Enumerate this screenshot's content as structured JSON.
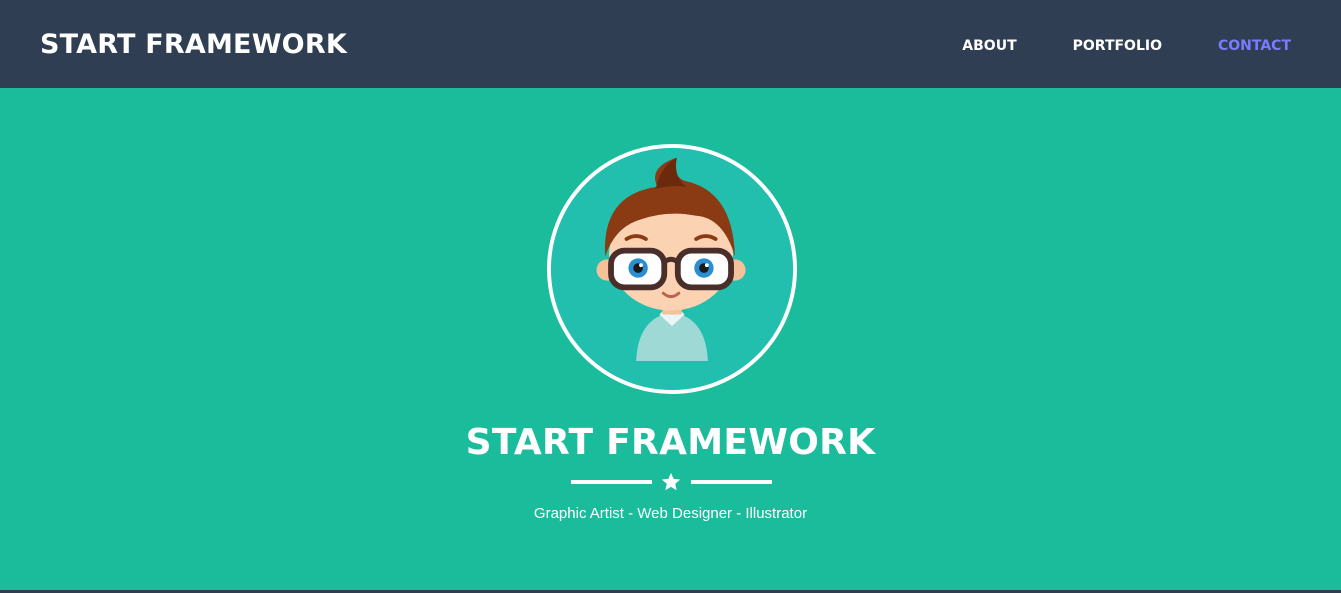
{
  "navbar": {
    "brand": "START FRAMEWORK",
    "links": [
      {
        "label": "ABOUT",
        "active": false
      },
      {
        "label": "PORTFOLIO",
        "active": false
      },
      {
        "label": "CONTACT",
        "active": true
      }
    ]
  },
  "masthead": {
    "avatar_icon": "avatar-icon",
    "title": "START FRAMEWORK",
    "divider_icon": "star-icon",
    "subtitle": "Graphic Artist - Web Designer - Illustrator"
  },
  "colors": {
    "navbar_bg": "#2f3e52",
    "masthead_bg": "#1abc9c",
    "active_link": "#7b7bff",
    "text": "#ffffff"
  }
}
